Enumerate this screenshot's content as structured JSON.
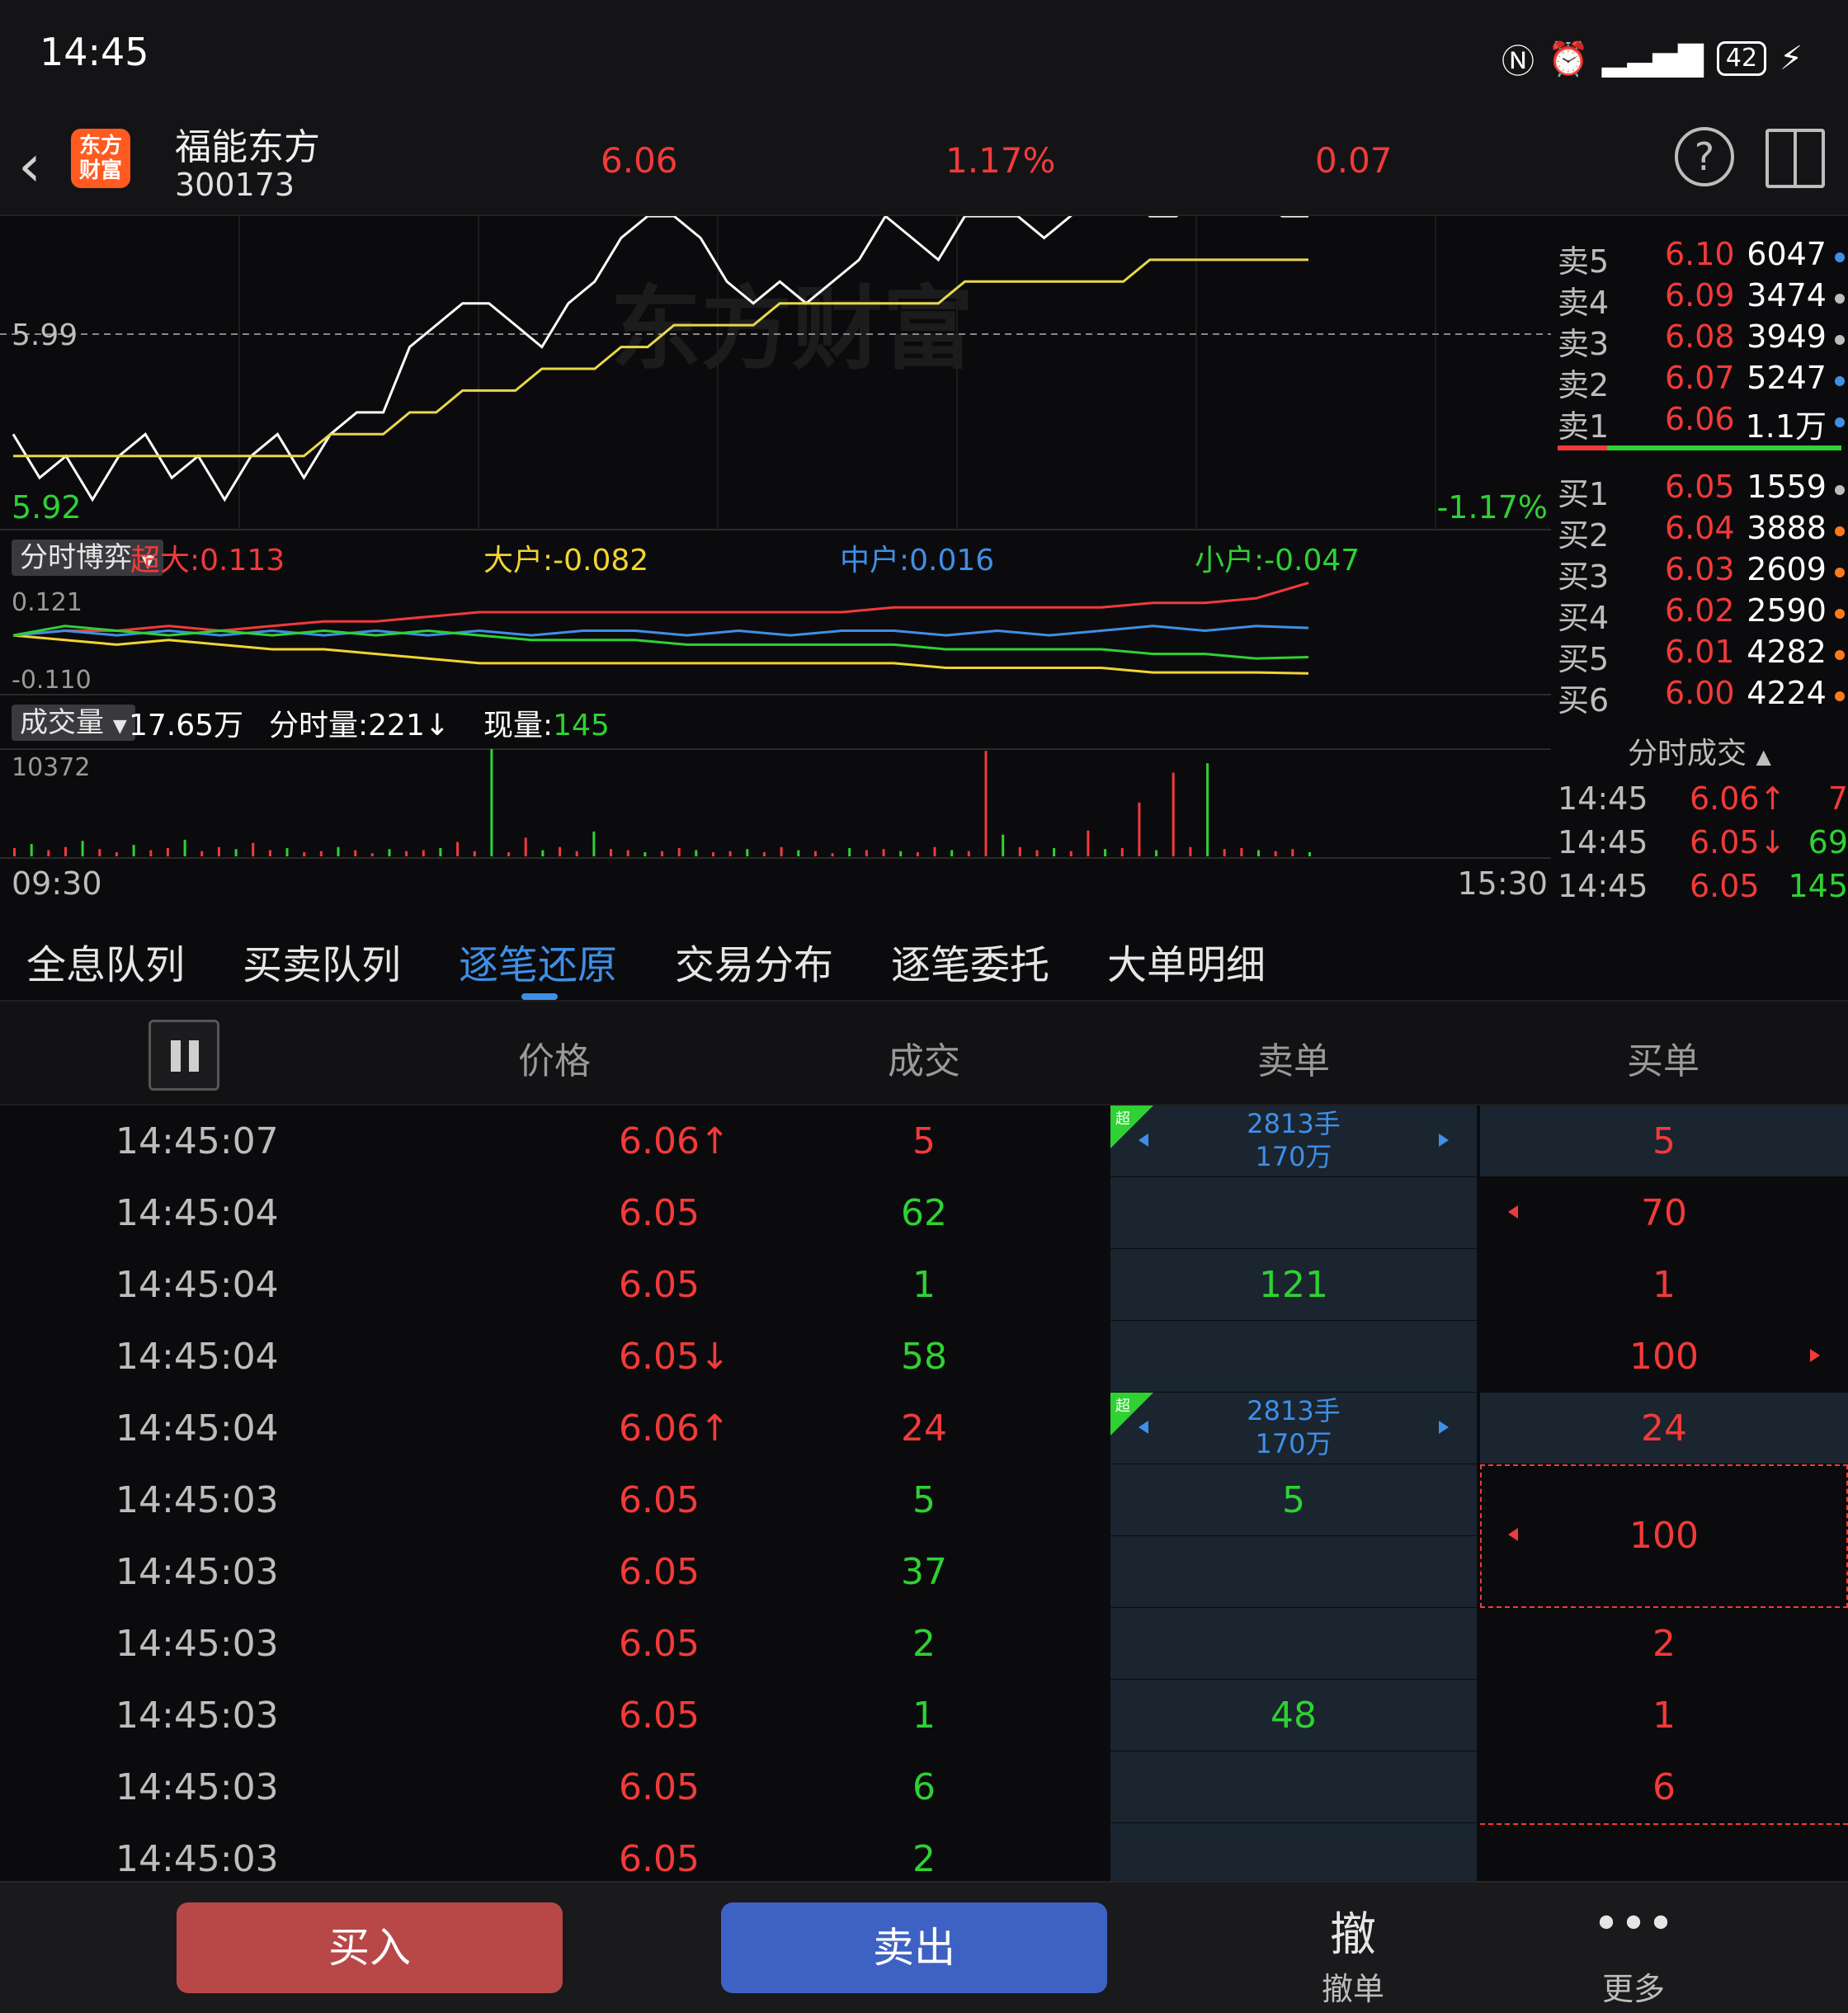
{
  "status_bar": {
    "time": "14:45",
    "battery": "42",
    "icons": [
      "nfc-icon",
      "alarm-icon",
      "signal-icon",
      "battery-icon",
      "charging-icon"
    ]
  },
  "header": {
    "logo_text_1": "东方",
    "logo_text_2": "财富",
    "stock_name": "福能东方",
    "stock_code": "300173",
    "price": "6.06",
    "change_pct": "1.17%",
    "change": "0.07"
  },
  "chart": {
    "watermark": "东方财富",
    "prev_close_label": "5.99",
    "low_label": "5.92",
    "low_pct_label": "-1.17%",
    "fund_tag": "分时博弈",
    "fund_super": "超大:0.113",
    "fund_big": "大户:-0.082",
    "fund_mid": "中户:0.016",
    "fund_small": "小户:-0.047",
    "fund_max": "0.121",
    "fund_min": "-0.110",
    "vol_tag": "成交量",
    "vol_total": "17.65万",
    "vol_minute_label": "分时量:221",
    "vol_current_label": "现量:",
    "vol_current": "145",
    "vol_max": "10372",
    "time_start": "09:30",
    "time_end": "15:30"
  },
  "chart_data": [
    {
      "type": "line",
      "title": "",
      "series": [
        {
          "name": "price",
          "values": [
            5.96,
            5.94,
            5.95,
            5.93,
            5.95,
            5.96,
            5.94,
            5.95,
            5.93,
            5.95,
            5.96,
            5.94,
            5.96,
            5.97,
            5.97,
            6.0,
            6.01,
            6.02,
            6.02,
            6.01,
            6.0,
            6.02,
            6.03,
            6.05,
            6.06,
            6.06,
            6.05,
            6.03,
            6.02,
            6.03,
            6.02,
            6.03,
            6.04,
            6.06,
            6.05,
            6.04,
            6.06,
            6.06,
            6.06,
            6.05,
            6.06,
            6.07,
            6.07,
            6.06,
            6.06,
            6.07,
            6.07,
            6.07,
            6.06,
            6.06
          ]
        },
        {
          "name": "average",
          "values": [
            5.95,
            5.95,
            5.95,
            5.95,
            5.95,
            5.95,
            5.95,
            5.95,
            5.95,
            5.95,
            5.95,
            5.95,
            5.96,
            5.96,
            5.96,
            5.97,
            5.97,
            5.98,
            5.98,
            5.98,
            5.99,
            5.99,
            5.99,
            6.0,
            6.0,
            6.01,
            6.01,
            6.01,
            6.01,
            6.02,
            6.02,
            6.02,
            6.02,
            6.02,
            6.02,
            6.02,
            6.03,
            6.03,
            6.03,
            6.03,
            6.03,
            6.03,
            6.03,
            6.04,
            6.04,
            6.04,
            6.04,
            6.04,
            6.04,
            6.04
          ]
        }
      ],
      "reference_line": 5.99,
      "ylim": [
        5.92,
        6.06
      ]
    },
    {
      "type": "line",
      "series": [
        {
          "name": "超大",
          "values": [
            0.0,
            0.01,
            0.01,
            0.02,
            0.01,
            0.02,
            0.03,
            0.03,
            0.04,
            0.05,
            0.05,
            0.05,
            0.05,
            0.05,
            0.05,
            0.05,
            0.05,
            0.06,
            0.06,
            0.06,
            0.06,
            0.06,
            0.07,
            0.07,
            0.08,
            0.113
          ]
        },
        {
          "name": "大户",
          "values": [
            0.0,
            -0.01,
            -0.02,
            -0.01,
            -0.02,
            -0.03,
            -0.03,
            -0.04,
            -0.05,
            -0.06,
            -0.06,
            -0.06,
            -0.06,
            -0.06,
            -0.06,
            -0.06,
            -0.06,
            -0.06,
            -0.07,
            -0.07,
            -0.07,
            -0.07,
            -0.08,
            -0.08,
            -0.08,
            -0.082
          ]
        },
        {
          "name": "中户",
          "values": [
            0.0,
            0.01,
            0.0,
            0.01,
            0.0,
            0.01,
            0.0,
            0.01,
            0.0,
            0.01,
            0.0,
            0.01,
            0.01,
            0.0,
            0.01,
            0.0,
            0.01,
            0.01,
            0.0,
            0.01,
            0.0,
            0.01,
            0.02,
            0.01,
            0.02,
            0.016
          ]
        },
        {
          "name": "小户",
          "values": [
            0.0,
            0.02,
            0.01,
            0.0,
            0.01,
            0.0,
            0.01,
            0.0,
            0.01,
            0.0,
            -0.01,
            -0.01,
            -0.01,
            -0.02,
            -0.02,
            -0.02,
            -0.02,
            -0.02,
            -0.03,
            -0.03,
            -0.03,
            -0.03,
            -0.04,
            -0.04,
            -0.05,
            -0.047
          ]
        }
      ],
      "ylim": [
        -0.11,
        0.121
      ]
    },
    {
      "type": "bar",
      "values": [
        800,
        1200,
        600,
        900,
        1500,
        700,
        400,
        1100,
        600,
        800,
        1600,
        500,
        900,
        700,
        1300,
        600,
        800,
        400,
        500,
        900,
        600,
        300,
        700,
        500,
        600,
        800,
        1400,
        500,
        10372,
        400,
        1800,
        600,
        900,
        500,
        2400,
        700,
        600,
        400,
        500,
        800,
        600,
        400,
        500,
        700,
        400,
        900,
        600,
        500,
        300,
        800,
        600,
        700,
        500,
        400,
        900,
        600,
        500,
        10200,
        2100,
        900,
        600,
        800,
        500,
        2500,
        700,
        800,
        5200,
        600,
        8100,
        900,
        9000,
        700,
        800,
        600,
        500,
        700,
        400
      ],
      "ylim": [
        0,
        10372
      ]
    }
  ],
  "order_book": {
    "asks": [
      {
        "label": "卖5",
        "price": "6.10",
        "vol": "6047",
        "dot": "#3f8fe6"
      },
      {
        "label": "卖4",
        "price": "6.09",
        "vol": "3474",
        "dot": "#bdbdbd"
      },
      {
        "label": "卖3",
        "price": "6.08",
        "vol": "3949",
        "dot": "#bdbdbd"
      },
      {
        "label": "卖2",
        "price": "6.07",
        "vol": "5247",
        "dot": "#3f8fe6"
      },
      {
        "label": "卖1",
        "price": "6.06",
        "vol": "1.1万",
        "dot": "#3f8fe6"
      }
    ],
    "bids": [
      {
        "label": "买1",
        "price": "6.05",
        "vol": "1559",
        "dot": "#bdbdbd"
      },
      {
        "label": "买2",
        "price": "6.04",
        "vol": "3888",
        "dot": "#ff7a1a"
      },
      {
        "label": "买3",
        "price": "6.03",
        "vol": "2609",
        "dot": "#ff7a1a"
      },
      {
        "label": "买4",
        "price": "6.02",
        "vol": "2590",
        "dot": "#ff7a1a"
      },
      {
        "label": "买5",
        "price": "6.01",
        "vol": "4282",
        "dot": "#ff7a1a"
      },
      {
        "label": "买6",
        "price": "6.00",
        "vol": "4224",
        "dot": "#ff7a1a"
      }
    ],
    "ticks_title": "分时成交",
    "ticks": [
      {
        "time": "14:45",
        "price": "6.06↑",
        "vol": "7",
        "vcolor": "#f23a3a"
      },
      {
        "time": "14:45",
        "price": "6.05↓",
        "vol": "69",
        "vcolor": "#2fd133"
      },
      {
        "time": "14:45",
        "price": "6.05",
        "vol": "145",
        "vcolor": "#2fd133"
      }
    ]
  },
  "tabs": [
    "全息队列",
    "买卖队列",
    "逐笔还原",
    "交易分布",
    "逐笔委托",
    "大单明细"
  ],
  "table": {
    "headers": {
      "price": "价格",
      "vol": "成交",
      "sell": "卖单",
      "buy": "买单"
    },
    "super_tag": "超",
    "rows": [
      {
        "time": "14:45:07",
        "price": "6.06↑",
        "price_color": "#f23a3a",
        "vol": "5",
        "vol_color": "#f23a3a",
        "sell": "",
        "sell_big_1": "2813手",
        "sell_big_2": "170万",
        "buy": "5"
      },
      {
        "time": "14:45:04",
        "price": "6.05",
        "price_color": "#f23a3a",
        "vol": "62",
        "vol_color": "#2fd133",
        "sell": "",
        "sell_big_1": "",
        "sell_big_2": "",
        "buy": "70"
      },
      {
        "time": "14:45:04",
        "price": "6.05",
        "price_color": "#f23a3a",
        "vol": "1",
        "vol_color": "#2fd133",
        "sell": "121",
        "sell_big_1": "",
        "sell_big_2": "",
        "buy": "1"
      },
      {
        "time": "14:45:04",
        "price": "6.05↓",
        "price_color": "#f23a3a",
        "vol": "58",
        "vol_color": "#2fd133",
        "sell": "",
        "sell_big_1": "",
        "sell_big_2": "",
        "buy": "100"
      },
      {
        "time": "14:45:04",
        "price": "6.06↑",
        "price_color": "#f23a3a",
        "vol": "24",
        "vol_color": "#f23a3a",
        "sell": "",
        "sell_big_1": "2813手",
        "sell_big_2": "170万",
        "buy": "24"
      },
      {
        "time": "14:45:03",
        "price": "6.05",
        "price_color": "#f23a3a",
        "vol": "5",
        "vol_color": "#2fd133",
        "sell": "5",
        "sell_big_1": "",
        "sell_big_2": "",
        "buy": ""
      },
      {
        "time": "14:45:03",
        "price": "6.05",
        "price_color": "#f23a3a",
        "vol": "37",
        "vol_color": "#2fd133",
        "sell": "",
        "sell_big_1": "",
        "sell_big_2": "",
        "buy": "100"
      },
      {
        "time": "14:45:03",
        "price": "6.05",
        "price_color": "#f23a3a",
        "vol": "2",
        "vol_color": "#2fd133",
        "sell": "",
        "sell_big_1": "",
        "sell_big_2": "",
        "buy": "2"
      },
      {
        "time": "14:45:03",
        "price": "6.05",
        "price_color": "#f23a3a",
        "vol": "1",
        "vol_color": "#2fd133",
        "sell": "48",
        "sell_big_1": "",
        "sell_big_2": "",
        "buy": "1"
      },
      {
        "time": "14:45:03",
        "price": "6.05",
        "price_color": "#f23a3a",
        "vol": "6",
        "vol_color": "#2fd133",
        "sell": "",
        "sell_big_1": "",
        "sell_big_2": "",
        "buy": "6"
      },
      {
        "time": "14:45:03",
        "price": "6.05",
        "price_color": "#f23a3a",
        "vol": "2",
        "vol_color": "#2fd133",
        "sell": "",
        "sell_big_1": "",
        "sell_big_2": "",
        "buy": ""
      }
    ]
  },
  "bottom": {
    "buy": "买入",
    "sell": "卖出",
    "cancel_icon": "撤",
    "cancel": "撤单",
    "more_icon": "•••",
    "more": "更多"
  }
}
